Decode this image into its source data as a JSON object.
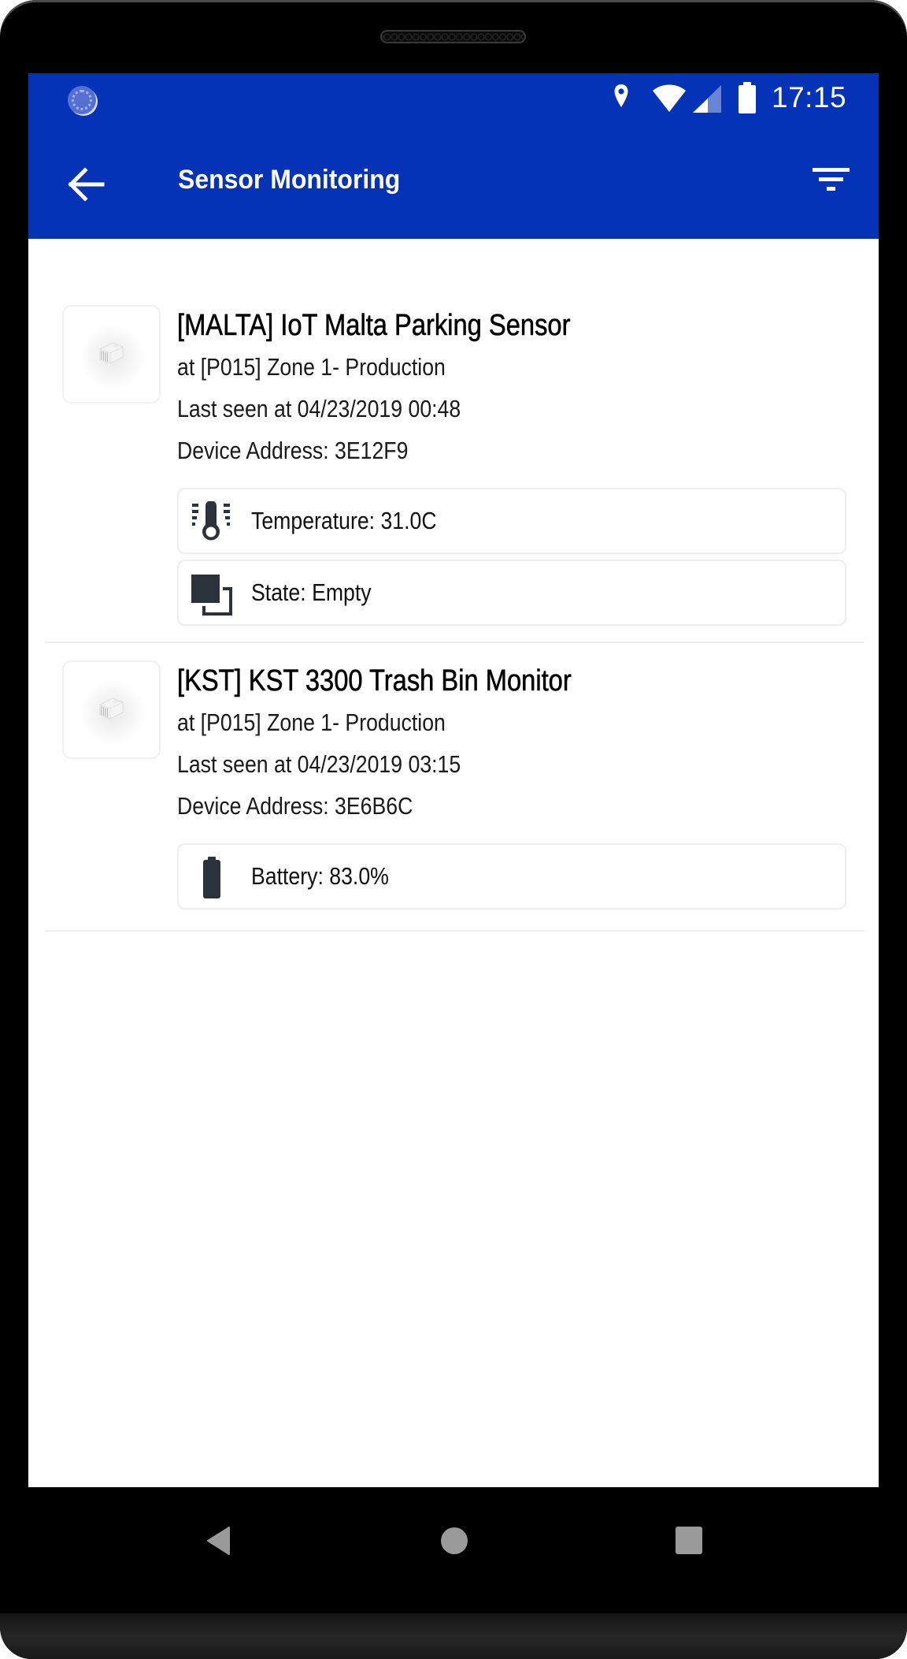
{
  "status_bar": {
    "time": "17:15",
    "icons": [
      "sync-icon",
      "location-icon",
      "wifi-icon",
      "signal-icon",
      "battery-icon"
    ]
  },
  "toolbar": {
    "title": "Sensor Monitoring",
    "back_icon": "arrow-left-icon",
    "filter_icon": "filter-icon"
  },
  "theme": {
    "primary": "#0533B7",
    "icon_dark": "#2B323B",
    "divider": "#EEEEEE"
  },
  "sensors": [
    {
      "title": "[MALTA] IoT Malta Parking Sensor",
      "location": "at [P015] Zone 1- Production",
      "last_seen": "Last seen at 04/23/2019 00:48",
      "address": "Device Address: 3E12F9",
      "readings": [
        {
          "icon": "thermometer-icon",
          "label": "Temperature: 31.0C"
        },
        {
          "icon": "state-icon",
          "label": "State: Empty"
        }
      ]
    },
    {
      "title": "[KST] KST 3300 Trash Bin Monitor",
      "location": "at [P015] Zone 1- Production",
      "last_seen": "Last seen at 04/23/2019 03:15",
      "address": "Device Address: 3E6B6C",
      "readings": [
        {
          "icon": "battery-icon",
          "label": "Battery: 83.0%"
        }
      ]
    }
  ],
  "nav_bar": {
    "buttons": [
      "back",
      "home",
      "recents"
    ]
  }
}
